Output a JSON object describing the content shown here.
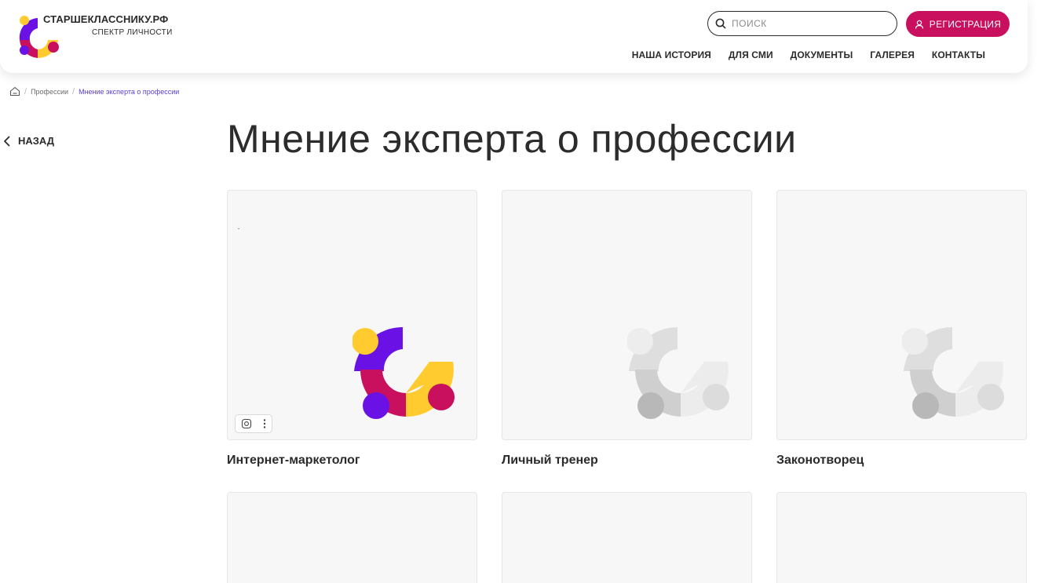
{
  "header": {
    "brand_name": "СТАРШЕКЛАССНИКУ.РФ",
    "brand_sub": "СПЕКТР ЛИЧНОСТИ",
    "search_placeholder": "ПОИСК",
    "register_label": "РЕГИСТРАЦИЯ",
    "nav": [
      "НАША ИСТОРИЯ",
      "ДЛЯ СМИ",
      "ДОКУМЕНТЫ",
      "ГАЛЕРЕЯ",
      "КОНТАКТЫ"
    ]
  },
  "breadcrumb": {
    "home_icon": "home-icon",
    "items": [
      "Профессии",
      "Мнение эксперта о профессии"
    ]
  },
  "back_label": "НАЗАД",
  "page_title": "Мнение эксперта о профессии",
  "cards": [
    {
      "label": "Интернет-маркетолог",
      "style": "color"
    },
    {
      "label": "Личный тренер",
      "style": "gray"
    },
    {
      "label": "Законотворец",
      "style": "gray"
    },
    {
      "label": "",
      "style": "blank"
    },
    {
      "label": "",
      "style": "blank"
    },
    {
      "label": "",
      "style": "blank"
    }
  ],
  "colors": {
    "accent": "#c8105e",
    "purple": "#6a12e6",
    "yellow": "#ffcb2e",
    "magenta": "#c8105e",
    "breadcrumb_current": "#5b3fd0"
  }
}
